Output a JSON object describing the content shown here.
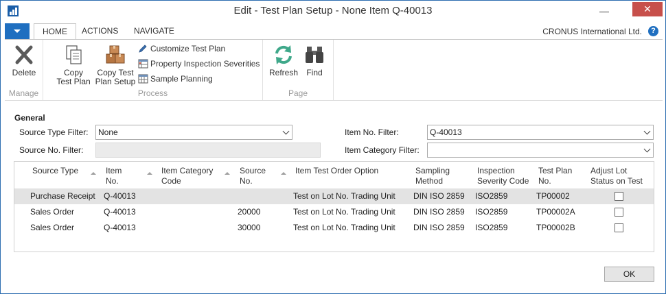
{
  "window": {
    "title": "Edit - Test Plan Setup - None   Item Q-40013",
    "minimize_glyph": "—",
    "close_glyph": "✕"
  },
  "ribbon": {
    "tabs": [
      {
        "label": "HOME",
        "active": true
      },
      {
        "label": "ACTIONS",
        "active": false
      },
      {
        "label": "NAVIGATE",
        "active": false
      }
    ],
    "company": "CRONUS International Ltd.",
    "help_glyph": "?",
    "groups": {
      "manage": {
        "label": "Manage",
        "delete": {
          "label": "Delete",
          "icon": "delete-x-icon"
        }
      },
      "process": {
        "label": "Process",
        "copy_test_plan": {
          "line1": "Copy",
          "line2": "Test Plan",
          "icon": "copy-documents-icon"
        },
        "copy_test_plan_setup": {
          "line1": "Copy Test",
          "line2": "Plan Setup",
          "icon": "boxes-icon"
        },
        "customize_test_plan": {
          "label": "Customize Test Plan",
          "icon": "pencil-icon"
        },
        "property_inspection_severities": {
          "label": "Property Inspection Severities",
          "icon": "table-icon"
        },
        "sample_planning": {
          "label": "Sample Planning",
          "icon": "grid-icon"
        }
      },
      "page": {
        "label": "Page",
        "refresh": {
          "label": "Refresh",
          "icon": "refresh-icon"
        },
        "find": {
          "label": "Find",
          "icon": "binoculars-icon"
        }
      }
    }
  },
  "general": {
    "title": "General",
    "source_type_filter": {
      "label": "Source Type Filter:",
      "value": "None"
    },
    "source_no_filter": {
      "label": "Source No. Filter:",
      "value": ""
    },
    "item_no_filter": {
      "label": "Item No. Filter:",
      "value": "Q-40013"
    },
    "item_category_filter": {
      "label": "Item Category Filter:",
      "value": ""
    }
  },
  "grid": {
    "columns": [
      {
        "line1": "Source Type",
        "line2": ""
      },
      {
        "line1": "Item",
        "line2": "No."
      },
      {
        "line1": "Item Category",
        "line2": "Code"
      },
      {
        "line1": "Source",
        "line2": "No."
      },
      {
        "line1": "Item Test Order Option",
        "line2": ""
      },
      {
        "line1": "Sampling",
        "line2": "Method"
      },
      {
        "line1": "Inspection",
        "line2": "Severity Code"
      },
      {
        "line1": "Test Plan",
        "line2": "No."
      },
      {
        "line1": "Adjust Lot",
        "line2": "Status on Test"
      }
    ],
    "rows": [
      {
        "source_type": "Purchase Receipt",
        "item_no": "Q-40013",
        "item_category_code": "",
        "source_no": "",
        "test_order_option": "Test on Lot No. Trading Unit",
        "sampling_method": "DIN ISO 2859",
        "severity_code": "ISO2859",
        "test_plan_no": "TP00002",
        "adjust_lot": false,
        "selected": true
      },
      {
        "source_type": "Sales Order",
        "item_no": "Q-40013",
        "item_category_code": "",
        "source_no": "20000",
        "test_order_option": "Test on Lot No. Trading Unit",
        "sampling_method": "DIN ISO 2859",
        "severity_code": "ISO2859",
        "test_plan_no": "TP00002A",
        "adjust_lot": false,
        "selected": false
      },
      {
        "source_type": "Sales Order",
        "item_no": "Q-40013",
        "item_category_code": "",
        "source_no": "30000",
        "test_order_option": "Test on Lot No. Trading Unit",
        "sampling_method": "DIN ISO 2859",
        "severity_code": "ISO2859",
        "test_plan_no": "TP00002B",
        "adjust_lot": false,
        "selected": false
      }
    ]
  },
  "footer": {
    "ok_label": "OK"
  },
  "colors": {
    "accent": "#1f6fc0",
    "close_button": "#c7504b",
    "selected_row": "#e3e3e3"
  }
}
